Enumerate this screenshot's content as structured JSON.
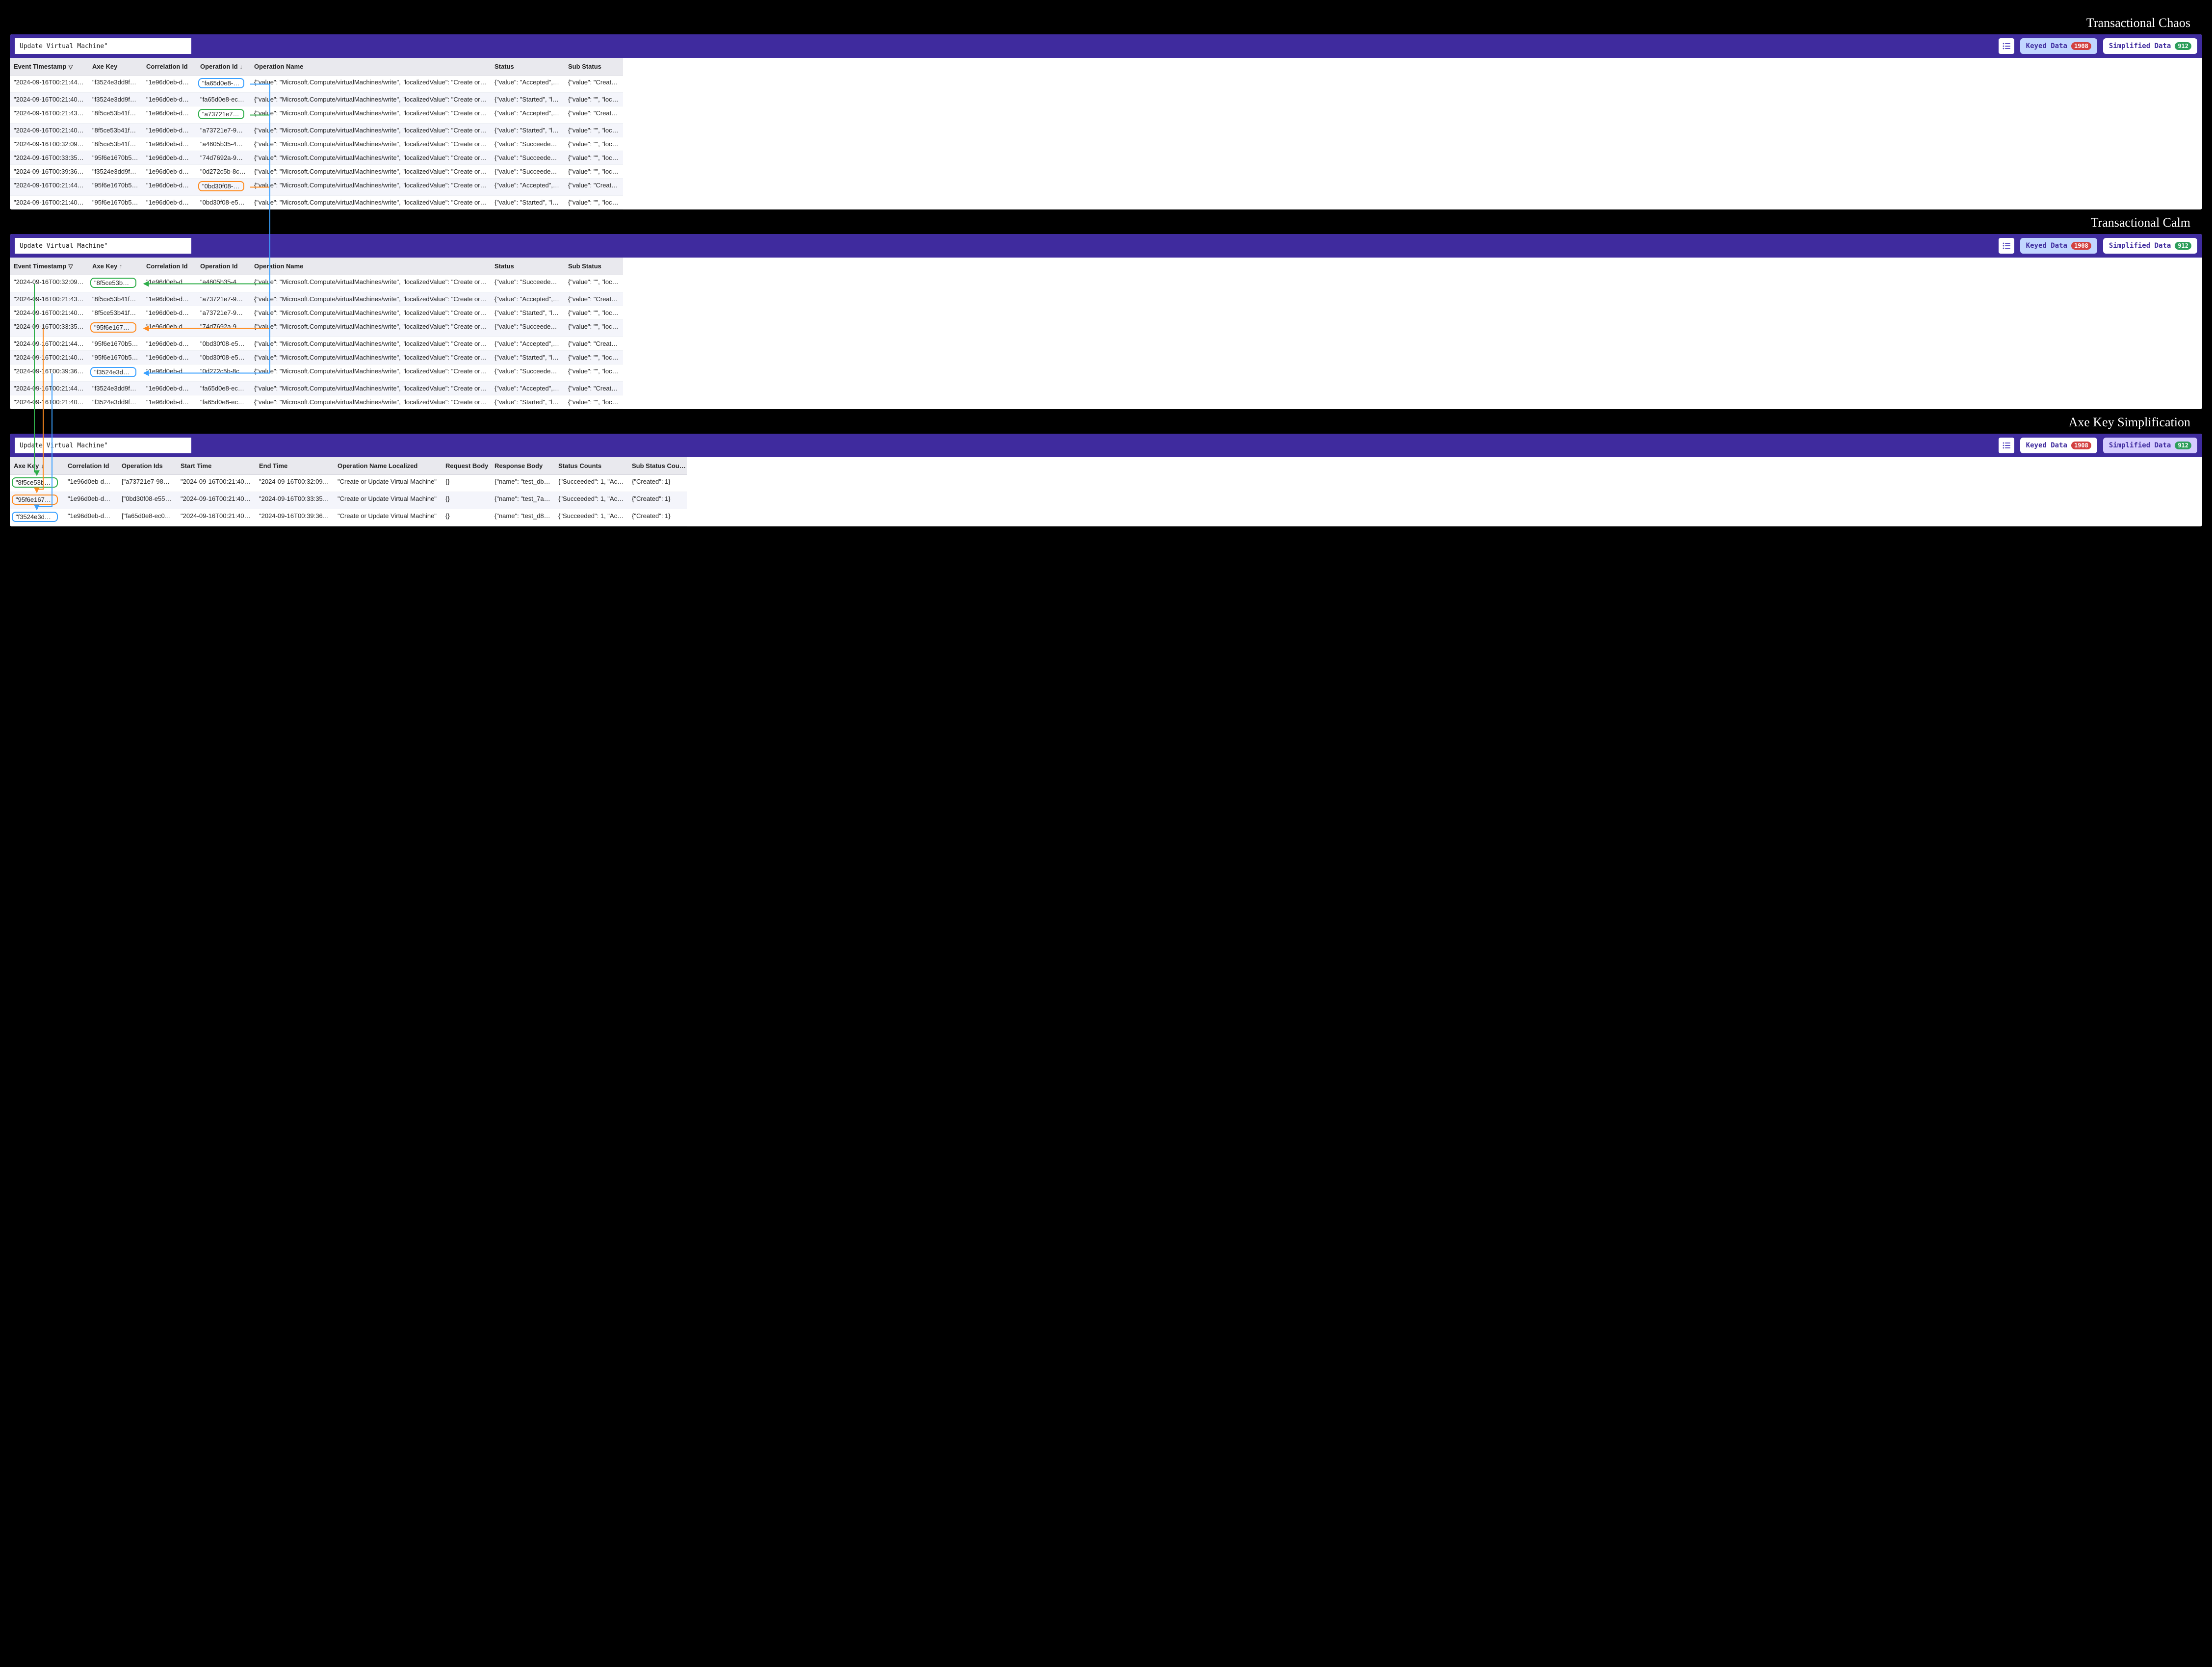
{
  "ui": {
    "search_value": "Update Virtual Machine\"",
    "keyed_label": "Keyed Data",
    "keyed_count": "1908",
    "simplified_label": "Simplified Data",
    "simplified_count": "912",
    "titles": {
      "chaos": "Transactional Chaos",
      "calm": "Transactional Calm",
      "simpl": "Axe Key Simplification"
    }
  },
  "panel1": {
    "headers": {
      "event_ts": "Event Timestamp",
      "axe_key": "Axe Key",
      "corr_id": "Correlation Id",
      "op_id": "Operation Id",
      "op_name": "Operation Name",
      "status": "Status",
      "sub_status": "Sub Status",
      "sort_ts_glyph": "▽",
      "sort_op_glyph": "↓"
    },
    "rows": [
      {
        "ts": "\"2024-09-16T00:21:44.7…",
        "axe": "\"f3524e3dd9fe3…",
        "corr": "\"1e96d0eb-d8f5-…",
        "op": "\"fa65d0e8-ec0a-…",
        "name": "{\"value\": \"Microsoft.Compute/virtualMachines/write\", \"localizedValue\": \"Create or Update Virtual Machine\"}",
        "status": "{\"value\": \"Accepted\", \"lo…",
        "sub": "{\"value\": \"Created\", \"l…",
        "op_box": "b-blue"
      },
      {
        "ts": "\"2024-09-16T00:21:40.2…",
        "axe": "\"f3524e3dd9fe3…",
        "corr": "\"1e96d0eb-d8f5-…",
        "op": "\"fa65d0e8-ec0a-…",
        "name": "{\"value\": \"Microsoft.Compute/virtualMachines/write\", \"localizedValue\": \"Create or Update Virtual Machine\"}",
        "status": "{\"value\": \"Started\", \"local…",
        "sub": "{\"value\": \"\", \"localized…"
      },
      {
        "ts": "\"2024-09-16T00:21:43.9…",
        "axe": "\"8f5ce53b41f73…",
        "corr": "\"1e96d0eb-d8f5-…",
        "op": "\"a73721e7-9830-…",
        "name": "{\"value\": \"Microsoft.Compute/virtualMachines/write\", \"localizedValue\": \"Create or Update Virtual Machine\"}",
        "status": "{\"value\": \"Accepted\", \"lo…",
        "sub": "{\"value\": \"Created\", \"l…",
        "op_box": "b-green"
      },
      {
        "ts": "\"2024-09-16T00:21:40.4…",
        "axe": "\"8f5ce53b41f73…",
        "corr": "\"1e96d0eb-d8f5-…",
        "op": "\"a73721e7-9830-…",
        "name": "{\"value\": \"Microsoft.Compute/virtualMachines/write\", \"localizedValue\": \"Create or Update Virtual Machine\"}",
        "status": "{\"value\": \"Started\", \"local…",
        "sub": "{\"value\": \"\", \"localized…"
      },
      {
        "ts": "\"2024-09-16T00:32:09.6…",
        "axe": "\"8f5ce53b41f73…",
        "corr": "\"1e96d0eb-d8f5-…",
        "op": "\"a4605b35-4375-…",
        "name": "{\"value\": \"Microsoft.Compute/virtualMachines/write\", \"localizedValue\": \"Create or Update Virtual Machine\"}",
        "status": "{\"value\": \"Succeeded\", \"l…",
        "sub": "{\"value\": \"\", \"localized…"
      },
      {
        "ts": "\"2024-09-16T00:33:35.5…",
        "axe": "\"95f6e1670b547…",
        "corr": "\"1e96d0eb-d8f5-…",
        "op": "\"74d7692a-9a9c-…",
        "name": "{\"value\": \"Microsoft.Compute/virtualMachines/write\", \"localizedValue\": \"Create or Update Virtual Machine\"}",
        "status": "{\"value\": \"Succeeded\", \"l…",
        "sub": "{\"value\": \"\", \"localized…"
      },
      {
        "ts": "\"2024-09-16T00:39:36.5…",
        "axe": "\"f3524e3dd9fe3…",
        "corr": "\"1e96d0eb-d8f5-…",
        "op": "\"0d272c5b-8c5d…",
        "name": "{\"value\": \"Microsoft.Compute/virtualMachines/write\", \"localizedValue\": \"Create or Update Virtual Machine\"}",
        "status": "{\"value\": \"Succeeded\", \"l…",
        "sub": "{\"value\": \"\", \"localized…"
      },
      {
        "ts": "\"2024-09-16T00:21:44.5…",
        "axe": "\"95f6e1670b547…",
        "corr": "\"1e96d0eb-d8f5-…",
        "op": "\"0bd30f08-e552-…",
        "name": "{\"value\": \"Microsoft.Compute/virtualMachines/write\", \"localizedValue\": \"Create or Update Virtual Machine\"}",
        "status": "{\"value\": \"Accepted\", \"lo…",
        "sub": "{\"value\": \"Created\", \"l…",
        "op_box": "b-orange"
      },
      {
        "ts": "\"2024-09-16T00:21:40.3…",
        "axe": "\"95f6e1670b547…",
        "corr": "\"1e96d0eb-d8f5-…",
        "op": "\"0bd30f08-e552-…",
        "name": "{\"value\": \"Microsoft.Compute/virtualMachines/write\", \"localizedValue\": \"Create or Update Virtual Machine\"}",
        "status": "{\"value\": \"Started\", \"local…",
        "sub": "{\"value\": \"\", \"localized…"
      }
    ]
  },
  "panel2": {
    "headers": {
      "event_ts": "Event Timestamp",
      "axe_key": "Axe Key",
      "corr_id": "Correlation Id",
      "op_id": "Operation Id",
      "op_name": "Operation Name",
      "status": "Status",
      "sub_status": "Sub Status",
      "sort_ts_glyph": "▽",
      "sort_axe_glyph": "↑"
    },
    "rows": [
      {
        "ts": "\"2024-09-16T00:32:09.6…",
        "axe": "\"8f5ce53b41f73…",
        "corr": "\"1e96d0eb-d8f5-…",
        "op": "\"a4605b35-4375-…",
        "name": "{\"value\": \"Microsoft.Compute/virtualMachines/write\", \"localizedValue\": \"Create or Update Virtual Machine\"}",
        "status": "{\"value\": \"Succeeded\", \"l…",
        "sub": "{\"value\": \"\", \"localized…",
        "axe_box": "b-green"
      },
      {
        "ts": "\"2024-09-16T00:21:43.9…",
        "axe": "\"8f5ce53b41f73…",
        "corr": "\"1e96d0eb-d8f5-…",
        "op": "\"a73721e7-9830-…",
        "name": "{\"value\": \"Microsoft.Compute/virtualMachines/write\", \"localizedValue\": \"Create or Update Virtual Machine\"}",
        "status": "{\"value\": \"Accepted\", \"lo…",
        "sub": "{\"value\": \"Created\", \"l…"
      },
      {
        "ts": "\"2024-09-16T00:21:40.4…",
        "axe": "\"8f5ce53b41f73…",
        "corr": "\"1e96d0eb-d8f5-…",
        "op": "\"a73721e7-9830-…",
        "name": "{\"value\": \"Microsoft.Compute/virtualMachines/write\", \"localizedValue\": \"Create or Update Virtual Machine\"}",
        "status": "{\"value\": \"Started\", \"local…",
        "sub": "{\"value\": \"\", \"localized…"
      },
      {
        "ts": "\"2024-09-16T00:33:35.5…",
        "axe": "\"95f6e1670b547…",
        "corr": "\"1e96d0eb-d8f5-…",
        "op": "\"74d7692a-9a9c-…",
        "name": "{\"value\": \"Microsoft.Compute/virtualMachines/write\", \"localizedValue\": \"Create or Update Virtual Machine\"}",
        "status": "{\"value\": \"Succeeded\", \"l…",
        "sub": "{\"value\": \"\", \"localized…",
        "axe_box": "b-orange"
      },
      {
        "ts": "\"2024-09-16T00:21:44.5…",
        "axe": "\"95f6e1670b547…",
        "corr": "\"1e96d0eb-d8f5-…",
        "op": "\"0bd30f08-e552-…",
        "name": "{\"value\": \"Microsoft.Compute/virtualMachines/write\", \"localizedValue\": \"Create or Update Virtual Machine\"}",
        "status": "{\"value\": \"Accepted\", \"lo…",
        "sub": "{\"value\": \"Created\", \"l…"
      },
      {
        "ts": "\"2024-09-16T00:21:40.3…",
        "axe": "\"95f6e1670b547…",
        "corr": "\"1e96d0eb-d8f5-…",
        "op": "\"0bd30f08-e552-…",
        "name": "{\"value\": \"Microsoft.Compute/virtualMachines/write\", \"localizedValue\": \"Create or Update Virtual Machine\"}",
        "status": "{\"value\": \"Started\", \"local…",
        "sub": "{\"value\": \"\", \"localized…"
      },
      {
        "ts": "\"2024-09-16T00:39:36.5…",
        "axe": "\"f3524e3dd9fe3…",
        "corr": "\"1e96d0eb-d8f5-…",
        "op": "\"0d272c5b-8c5d…",
        "name": "{\"value\": \"Microsoft.Compute/virtualMachines/write\", \"localizedValue\": \"Create or Update Virtual Machine\"}",
        "status": "{\"value\": \"Succeeded\", \"l…",
        "sub": "{\"value\": \"\", \"localized…",
        "axe_box": "b-blue"
      },
      {
        "ts": "\"2024-09-16T00:21:44.7…",
        "axe": "\"f3524e3dd9fe3…",
        "corr": "\"1e96d0eb-d8f5-…",
        "op": "\"fa65d0e8-ec0a-…",
        "name": "{\"value\": \"Microsoft.Compute/virtualMachines/write\", \"localizedValue\": \"Create or Update Virtual Machine\"}",
        "status": "{\"value\": \"Accepted\", \"lo…",
        "sub": "{\"value\": \"Created\", \"l…"
      },
      {
        "ts": "\"2024-09-16T00:21:40.2…",
        "axe": "\"f3524e3dd9fe3…",
        "corr": "\"1e96d0eb-d8f5-…",
        "op": "\"fa65d0e8-ec0a-…",
        "name": "{\"value\": \"Microsoft.Compute/virtualMachines/write\", \"localizedValue\": \"Create or Update Virtual Machine\"}",
        "status": "{\"value\": \"Started\", \"local…",
        "sub": "{\"value\": \"\", \"localized…"
      }
    ]
  },
  "panel3": {
    "headers": {
      "axe_key": "Axe Key",
      "corr_id": "Correlation Id",
      "op_ids": "Operation Ids",
      "start": "Start Time",
      "end": "End Time",
      "op_name_loc": "Operation Name Localized",
      "req_body": "Request Body",
      "resp_body": "Response Body",
      "status_counts": "Status Counts",
      "sub_status_counts": "Sub Status Cou…",
      "sort_axe_glyph": "↓"
    },
    "rows": [
      {
        "axe": "\"8f5ce53b41f7…",
        "corr": "\"1e96d0eb-d8f…",
        "ops": "[\"a73721e7-983…",
        "start": "\"2024-09-16T00:21:40.41…",
        "end": "\"2024-09-16T00:32:09…",
        "loc": "\"Create or Update Virtual Machine\"",
        "req": "{}",
        "resp": "{\"name\": \"test_dbe…",
        "sc": "{\"Succeeded\": 1, \"Acc…",
        "ssc": "{\"Created\": 1}",
        "axe_box": "b-green"
      },
      {
        "axe": "\"95f6e1670b5…",
        "corr": "\"1e96d0eb-d8f…",
        "ops": "[\"0bd30f08-e55…",
        "start": "\"2024-09-16T00:21:40…",
        "end": "\"2024-09-16T00:33:35…",
        "loc": "\"Create or Update Virtual Machine\"",
        "req": "{}",
        "resp": "{\"name\": \"test_7a1…",
        "sc": "{\"Succeeded\": 1, \"Acc…",
        "ssc": "{\"Created\": 1}",
        "axe_box": "b-orange"
      },
      {
        "axe": "\"f3524e3dd9fe…",
        "corr": "\"1e96d0eb-d8f…",
        "ops": "[\"fa65d0e8-ec0…",
        "start": "\"2024-09-16T00:21:40.24…",
        "end": "\"2024-09-16T00:39:36…",
        "loc": "\"Create or Update Virtual Machine\"",
        "req": "{}",
        "resp": "{\"name\": \"test_d82…",
        "sc": "{\"Succeeded\": 1, \"Acc…",
        "ssc": "{\"Created\": 1}",
        "axe_box": "b-blue"
      }
    ]
  }
}
